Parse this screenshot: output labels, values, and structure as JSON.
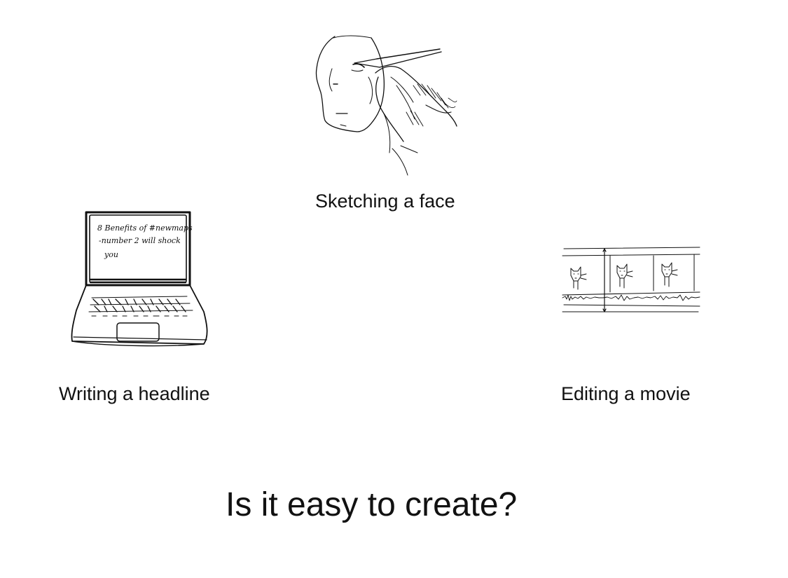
{
  "items": [
    {
      "caption": "Sketching a face",
      "icon": "face-sketch-icon"
    },
    {
      "caption": "Writing a headline",
      "icon": "laptop-icon",
      "screen_text": [
        "8 Benefits of #newmaps",
        "-number 2 will shock",
        "you"
      ]
    },
    {
      "caption": "Editing a movie",
      "icon": "video-timeline-icon"
    }
  ],
  "question": "Is it easy to create?"
}
